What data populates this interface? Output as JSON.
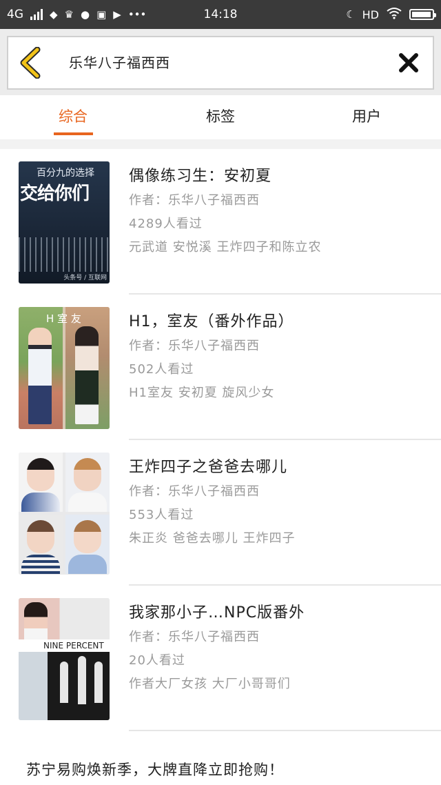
{
  "status_bar": {
    "network": "4G",
    "time": "14:18",
    "hd_label": "HD",
    "battery_level_percent": 95,
    "left_icons": [
      "signal-icon",
      "app-icon",
      "crown-icon",
      "qq-icon",
      "s-icon",
      "video-icon",
      "more-icon"
    ],
    "right_icons": [
      "moon-icon",
      "wifi-icon",
      "battery-icon"
    ]
  },
  "search": {
    "query": "乐华八子福西西"
  },
  "tabs": {
    "items": [
      {
        "label": "综合",
        "active": true
      },
      {
        "label": "标签",
        "active": false
      },
      {
        "label": "用户",
        "active": false
      }
    ],
    "accent_color": "#e8651f"
  },
  "results": [
    {
      "title": "偶像练习生：安初夏",
      "author": "作者：乐华八子福西西",
      "views": "4289人看过",
      "tags": "元武道 安悦溪 王炸四子和陈立农",
      "cover_text_1": "百分九的选择",
      "cover_text_2": "交给你们",
      "cover_watermark": "头条号 / 互联网"
    },
    {
      "title": "H1，室友（番外作品）",
      "author": "作者：乐华八子福西西",
      "views": "502人看过",
      "tags": "H1室友 安初夏 旋风少女",
      "cover_text_1": "H 室 友"
    },
    {
      "title": "王炸四子之爸爸去哪儿",
      "author": "作者：乐华八子福西西",
      "views": "553人看过",
      "tags": "朱正炎 爸爸去哪儿 王炸四子"
    },
    {
      "title": "我家那小子…NPC版番外",
      "author": "作者：乐华八子福西西",
      "views": "20人看过",
      "tags": "作者大厂女孩 大厂小哥哥们",
      "cover_text_1": "NINE PERCENT"
    }
  ],
  "footer": {
    "ad_text": "苏宁易购焕新季，大牌直降立即抢购！"
  }
}
